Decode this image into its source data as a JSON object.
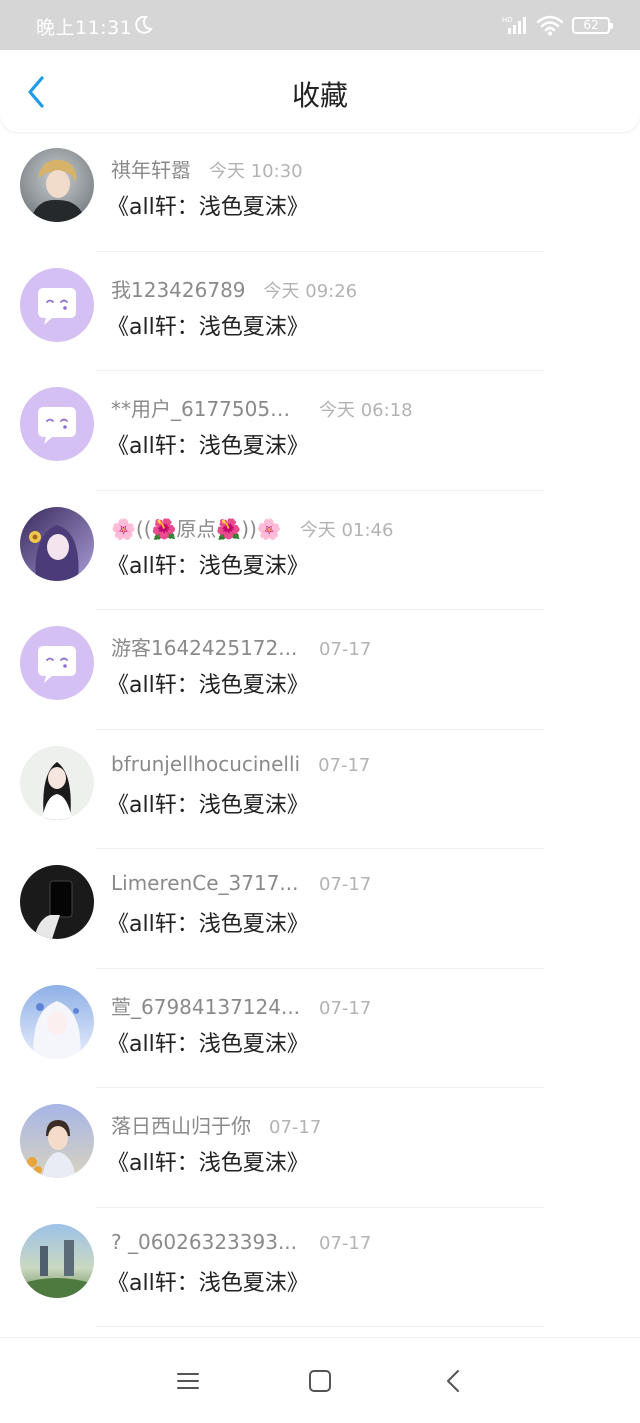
{
  "status_bar": {
    "time": "晚上11:31",
    "network": "HD",
    "battery": "62"
  },
  "header": {
    "title": "收藏"
  },
  "items": [
    {
      "name": "祺年轩嚣",
      "time": "今天 10:30",
      "title": "《all轩：浅色夏沫》",
      "avatar": "photo-anime-boy"
    },
    {
      "name": "我123426789",
      "time": "今天 09:26",
      "title": "《all轩：浅色夏沫》",
      "avatar": "default-chat-bubble"
    },
    {
      "name": "**用户_61775053...",
      "time": "今天 06:18",
      "title": "《all轩：浅色夏沫》",
      "avatar": "default-chat-bubble"
    },
    {
      "name": "🌸((🌺原点🌺))🌸",
      "time": "今天 01:46",
      "title": "《all轩：浅色夏沫》",
      "avatar": "photo-anime-girl-purple"
    },
    {
      "name": "游客1642425172...",
      "time": "07-17",
      "title": "《all轩：浅色夏沫》",
      "avatar": "default-chat-bubble"
    },
    {
      "name": "bfrunjellhocucinelli",
      "time": "07-17",
      "title": "《all轩：浅色夏沫》",
      "avatar": "photo-girl-white-dress"
    },
    {
      "name": "LimerenCe_3717...",
      "time": "07-17",
      "title": "《all轩：浅色夏沫》",
      "avatar": "photo-hand-phone-dark"
    },
    {
      "name": "萱_67984137124...",
      "time": "07-17",
      "title": "《all轩：浅色夏沫》",
      "avatar": "photo-anime-girl-white-hair"
    },
    {
      "name": "落日西山归于你",
      "time": "07-17",
      "title": "《all轩：浅色夏沫》",
      "avatar": "photo-boy-flowers"
    },
    {
      "name": "? _06026323393...",
      "time": "07-17",
      "title": "《all轩：浅色夏沫》",
      "avatar": "photo-scenery"
    }
  ],
  "colors": {
    "accent": "#1e9be9",
    "status_bar_bg": "#d6d6d6",
    "default_avatar_bg": "#d4c0f3"
  },
  "bottom_nav": [
    "menu-icon",
    "home-square-icon",
    "back-triangle-icon"
  ]
}
